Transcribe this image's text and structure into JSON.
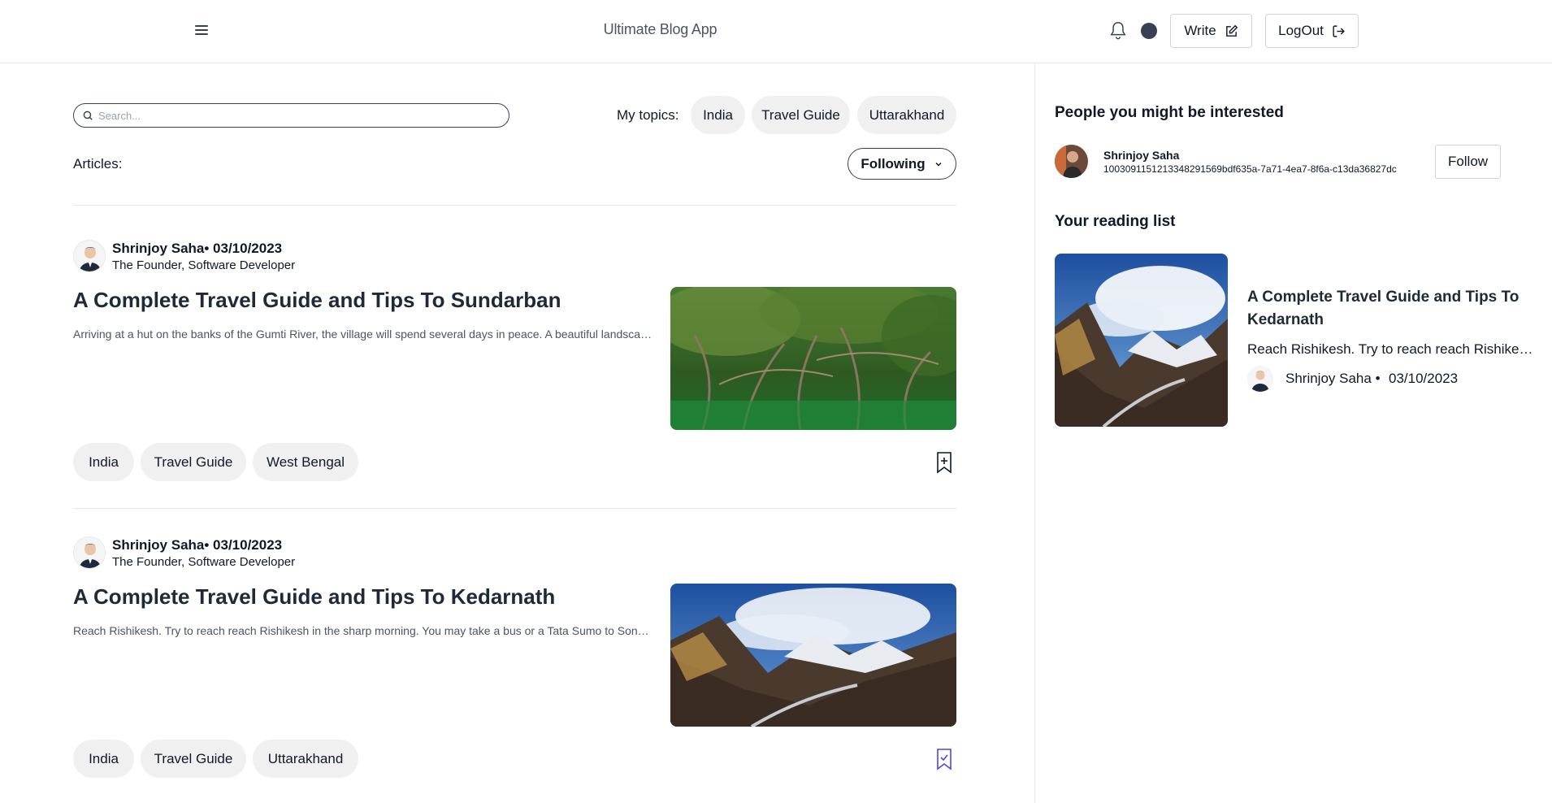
{
  "header": {
    "app_title": "Ultimate Blog App",
    "write_label": "Write",
    "logout_label": "LogOut"
  },
  "main": {
    "search_placeholder": "Search...",
    "topics_label": "My topics:",
    "topics": [
      "India",
      "Travel Guide",
      "Uttarakhand"
    ],
    "articles_label": "Articles:",
    "filter_label": "Following",
    "articles": [
      {
        "author_line": "Shrinjoy Saha• 03/10/2023",
        "author_role": "The Founder, Software Developer",
        "title": "A Complete Travel Guide and Tips To Sundarban",
        "excerpt": "Arriving at a hut on the banks of the Gumti River, the village will spend several days in peace. A beautiful landscape awaits",
        "tags": [
          "India",
          "Travel Guide",
          "West Bengal"
        ],
        "bookmarked": false
      },
      {
        "author_line": "Shrinjoy Saha• 03/10/2023",
        "author_role": "The Founder, Software Developer",
        "title": "A Complete Travel Guide and Tips To Kedarnath",
        "excerpt": "Reach Rishikesh. Try to reach reach Rishikesh in the sharp morning. You may take a bus or a Tata Sumo to Sonprayag",
        "tags": [
          "India",
          "Travel Guide",
          "Uttarakhand"
        ],
        "bookmarked": true
      }
    ]
  },
  "sidebar": {
    "people_heading": "People you might be interested",
    "suggestion": {
      "name": "Shrinjoy Saha",
      "id": "100309115121334829156​9bdf635a-7a71-4ea7-8f6a-c13da36827dc",
      "follow_label": "Follow"
    },
    "reading_heading": "Your reading list",
    "reading_item": {
      "title": "A Complete Travel Guide and Tips To Kedarnath",
      "excerpt": "Reach Rishikesh. Try to reach reach Rishikesh in the sharp morning.",
      "author": "Shrinjoy Saha •",
      "date": "03/10/2023"
    }
  },
  "colors": {
    "accent_bookmarked": "#4f46e5",
    "chip_bg": "#f0f0f0",
    "border": "#e5e7eb"
  }
}
